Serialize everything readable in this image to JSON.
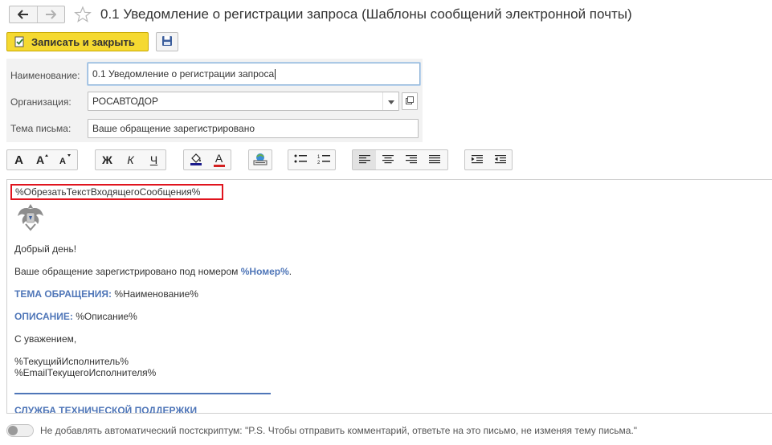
{
  "window": {
    "title": "0.1 Уведомление о регистрации запроса (Шаблоны сообщений электронной почты)"
  },
  "icons": {
    "back": "arrow-left-icon",
    "forward": "arrow-right-icon",
    "favorite": "star-icon",
    "save": "floppy-disk-icon",
    "dropdown": "chevron-down-icon",
    "open": "open-in-new-icon",
    "emblem": "coat-of-arms-icon"
  },
  "toolbar": {
    "save_close_label": "Записать и закрыть"
  },
  "form": {
    "name_label": "Наименование:",
    "name_value": "0.1 Уведомление о регистрации запроса",
    "org_label": "Организация:",
    "org_value": "РОСАВТОДОР",
    "subject_label": "Тема письма:",
    "subject_value": "Ваше обращение зарегистрировано"
  },
  "format_toolbar": {
    "bold": "Ж",
    "italic": "К",
    "underline": "Ч",
    "font_color": "A",
    "font_a": "A"
  },
  "editor": {
    "trim_macro": "%ОбрезатьТекстВходящегоСообщения%",
    "greeting": "Добрый день!",
    "registered_text": "Ваше обращение зарегистрировано под номером ",
    "number_macro": "%Номер%",
    "registered_end": ".",
    "topic_label": "ТЕМА ОБРАЩЕНИЯ:",
    "topic_value": " %Наименование%",
    "desc_label": "ОПИСАНИЕ:",
    "desc_value": " %Описание%",
    "regards": "С уважением,",
    "executor": "%ТекущийИсполнитель%",
    "executor_email": "%EmailТекущегоИсполнителя%",
    "support_heading": "СЛУЖБА ТЕХНИЧЕСКОЙ ПОДДЕРЖКИ"
  },
  "footer": {
    "postscript_toggle_on": false,
    "postscript_text": "Не добавлять автоматический постскриптум: \"P.S. Чтобы отправить комментарий, ответьте на это письмо, не изменяя тему письма.\""
  },
  "colors": {
    "accent_yellow": "#f5d931",
    "macro_blue": "#4f76b8",
    "highlight_red": "#e0141e"
  }
}
